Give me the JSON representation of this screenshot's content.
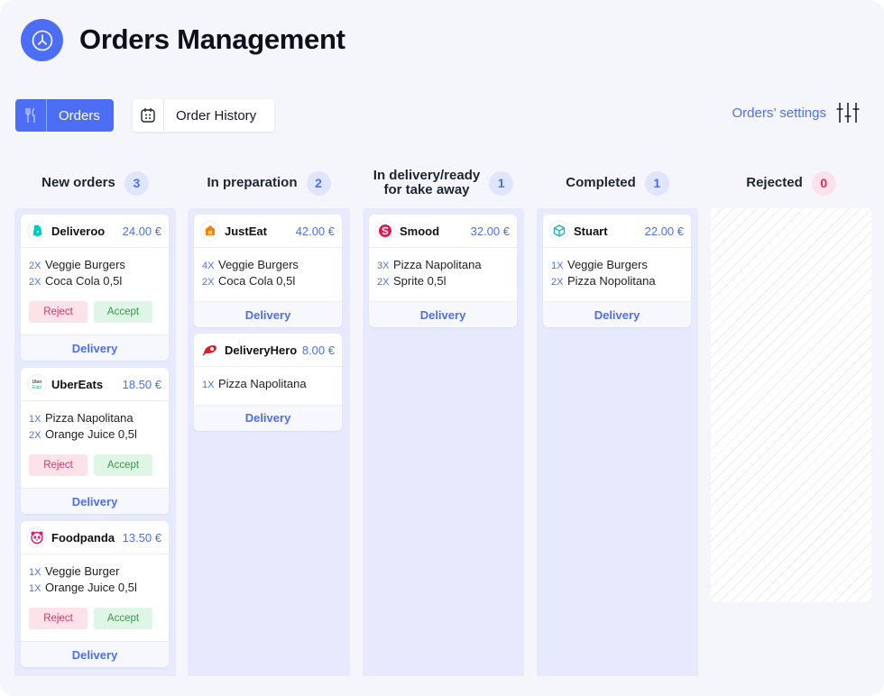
{
  "header": {
    "title": "Orders Management",
    "logo_icon": "clock-icon",
    "accent": "#4c6ef5"
  },
  "toolbar": {
    "orders_label": "Orders",
    "orders_icon": "fork-knife-icon",
    "history_label": "Order History",
    "history_icon": "calendar-icon",
    "settings_label": "Orders’ settings",
    "settings_icon": "sliders-icon"
  },
  "columns": [
    {
      "title": "New orders",
      "count": "3",
      "cards": [
        {
          "brand": "Deliveroo",
          "price": "24.00 €",
          "items": [
            {
              "qty": "2X",
              "name": "Veggie Burgers"
            },
            {
              "qty": "2X",
              "name": "Coca Cola 0,5l"
            }
          ],
          "reject": "Reject",
          "accept": "Accept",
          "footer": "Delivery"
        },
        {
          "brand": "UberEats",
          "price": "18.50 €",
          "items": [
            {
              "qty": "1X",
              "name": "Pizza Napolitana"
            },
            {
              "qty": "2X",
              "name": "Orange Juice 0,5l"
            }
          ],
          "reject": "Reject",
          "accept": "Accept",
          "footer": "Delivery"
        },
        {
          "brand": "Foodpanda",
          "price": "13.50 €",
          "items": [
            {
              "qty": "1X",
              "name": "Veggie Burger"
            },
            {
              "qty": "1X",
              "name": "Orange Juice 0,5l"
            }
          ],
          "reject": "Reject",
          "accept": "Accept",
          "footer": "Delivery"
        }
      ]
    },
    {
      "title": "In preparation",
      "count": "2",
      "cards": [
        {
          "brand": "JustEat",
          "price": "42.00 €",
          "items": [
            {
              "qty": "4X",
              "name": "Veggie Burgers"
            },
            {
              "qty": "2X",
              "name": "Coca Cola 0,5l"
            }
          ],
          "footer": "Delivery"
        },
        {
          "brand": "DeliveryHero",
          "price": "8.00 €",
          "items": [
            {
              "qty": "1X",
              "name": "Pizza Napolitana"
            }
          ],
          "footer": "Delivery"
        }
      ]
    },
    {
      "title_line1": "In delivery/ready",
      "title_line2": "for take away",
      "count": "1",
      "cards": [
        {
          "brand": "Smood",
          "price": "32.00 €",
          "items": [
            {
              "qty": "3X",
              "name": "Pizza Napolitana"
            },
            {
              "qty": "2X",
              "name": "Sprite 0,5l"
            }
          ],
          "footer": "Delivery"
        }
      ]
    },
    {
      "title": "Completed",
      "count": "1",
      "cards": [
        {
          "brand": "Stuart",
          "price": "22.00 €",
          "items": [
            {
              "qty": "1X",
              "name": "Veggie Burgers"
            },
            {
              "qty": "2X",
              "name": "Pizza Nopolitana"
            }
          ],
          "footer": "Delivery"
        }
      ]
    },
    {
      "title": "Rejected",
      "count": "0",
      "cards": []
    }
  ]
}
